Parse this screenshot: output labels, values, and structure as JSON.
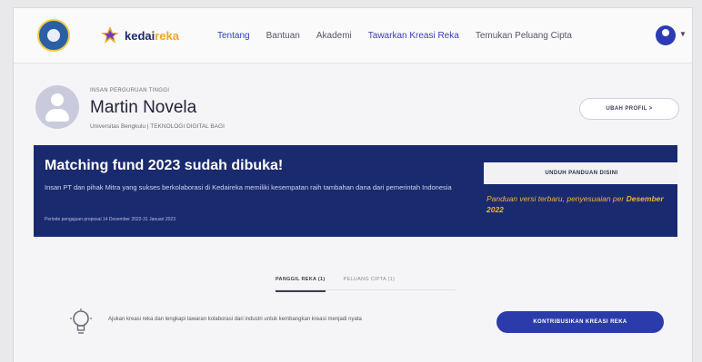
{
  "header": {
    "brand": {
      "name_main": "kedai",
      "name_accent": "reka"
    },
    "nav": [
      {
        "label": "Tentang",
        "style": "active"
      },
      {
        "label": "Bantuan",
        "style": ""
      },
      {
        "label": "Akademi",
        "style": ""
      },
      {
        "label": "Tawarkan Kreasi Reka",
        "style": "purple"
      },
      {
        "label": "Temukan Peluang Cipta",
        "style": ""
      }
    ]
  },
  "profile": {
    "role": "INSAN PERGURUAN TINGGI",
    "name": "Martin Novela",
    "university": "Universitas Bengkulu | TEKNOLOGI DIGITAL BAGI",
    "edit_label": "UBAH PROFIL >"
  },
  "banner": {
    "title": "Matching fund 2023 sudah dibuka!",
    "description": "Insan PT dan pihak Mitra yang sukses berkolaborasi di Kedaireka memiliki kesempatan raih tambahan dana dari pemerintah Indonesia",
    "period": "Periode pengajuan proposal 14 Desember 2022-31 Januari 2023",
    "download_label": "UNDUH PANDUAN DISINI",
    "note_prefix": "Panduan versi terbaru, penyesuaian per",
    "note_emphasis": "Desember 2022"
  },
  "tabs": [
    {
      "label": "PANGGIL REKA (1)",
      "active": true
    },
    {
      "label": "PELUANG CIPTA (1)",
      "active": false
    }
  ],
  "submission": {
    "text": "Ajukan kreasi reka dan lengkapi tawaran kolaborasi dari industri untuk kembangkan kreasi menjadi nyata",
    "button_label": "KONTRIBUSIKAN KREASI REKA"
  },
  "colors": {
    "brand_navy": "#1a2a6e",
    "accent_orange": "#f0b23a",
    "primary_button": "#2b3bac"
  }
}
